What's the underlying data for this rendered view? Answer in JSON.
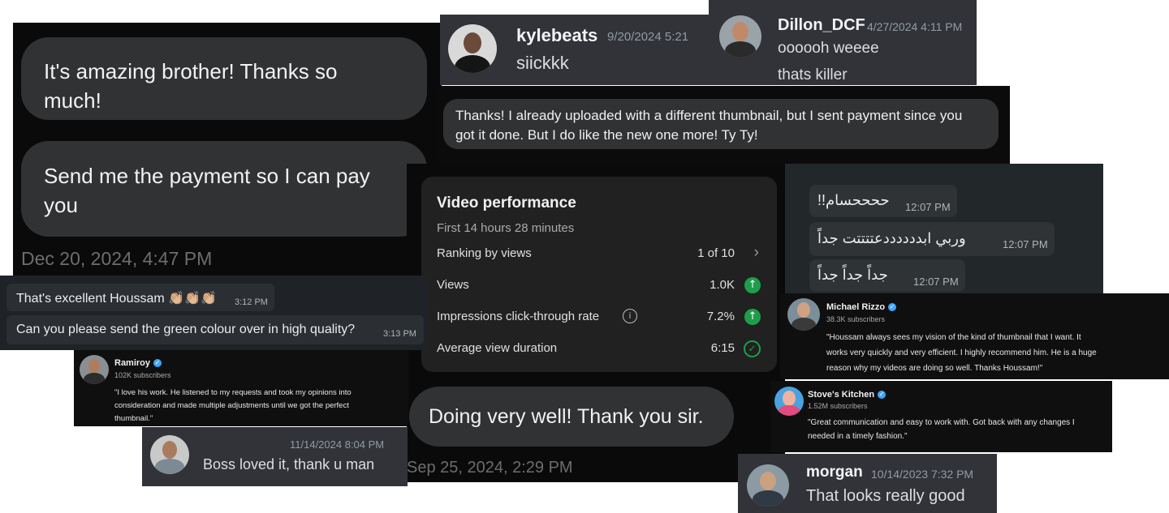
{
  "chat_black": {
    "msg1": "It's amazing brother! Thanks so much!",
    "msg1_l1": "It's amazing brother! Thanks so",
    "msg1_l2": "much!",
    "msg2_l1": "Send me the payment so I can pay",
    "msg2_l2": "you",
    "timestamp": "Dec 20, 2024, 4:47 PM"
  },
  "kylebeats": {
    "username": "kylebeats",
    "time": "9/20/2024 5:21",
    "message": "siickkk"
  },
  "dillon": {
    "username": "Dillon_DCF",
    "time": "4/27/2024 4:11 PM",
    "line1": "oooooh weeee",
    "line2": "thats killer"
  },
  "thanks_bubble": {
    "l1": "Thanks! I already uploaded with a different thumbnail, but I sent payment since you",
    "l2": "got it done. But I do like the new one more! Ty Ty!"
  },
  "video_performance": {
    "title": "Video performance",
    "subtitle": "First 14 hours 28 minutes",
    "rows": [
      {
        "label": "Ranking by views",
        "value": "1 of 10",
        "indicator": "chevron-right"
      },
      {
        "label": "Views",
        "value": "1.0K",
        "indicator": "up-arrow-green"
      },
      {
        "label": "Impressions click-through rate",
        "value": "7.2%",
        "indicator": "up-arrow-green"
      },
      {
        "label": "Average view duration",
        "value": "6:15",
        "indicator": "check-circle"
      }
    ],
    "reply": "Doing very well! Thank you sir.",
    "timestamp": "Sep 25, 2024, 2:29 PM"
  },
  "arabic_chat": {
    "messages": [
      {
        "text": "ححححسام!!",
        "time": "12:07 PM"
      },
      {
        "text": "وربي ابددددددعتتتتت جداً",
        "time": "12:07 PM"
      },
      {
        "text": "جداً جداً جداً",
        "time": "12:07 PM"
      }
    ]
  },
  "whatsapp_chat": {
    "messages": [
      {
        "text": "That's excellent Houssam 👏🏼👏🏼👏🏼",
        "time": "3:12 PM"
      },
      {
        "text": "Can you please send the green colour over in high quality?",
        "time": "3:13 PM"
      }
    ]
  },
  "ramiroy": {
    "name": "Ramiroy",
    "subs": "102K subscribers",
    "l1": "\"I love his work. He listened to my requests and took my opinions into",
    "l2": "consideration and made multiple adjustments until we got the perfect",
    "l3": "thumbnail.\""
  },
  "michael": {
    "name": "Michael Rizzo",
    "subs": "38.3K subscribers",
    "l1": "\"Houssam always sees my vision of the kind of thumbnail that I want. It",
    "l2": "works very quickly and very efficient. I highly recommend him. He is a huge",
    "l3": "reason why my videos are doing so well. Thanks Houssam!\""
  },
  "stoves": {
    "name": "Stove's Kitchen",
    "subs": "1.52M subscribers",
    "l1": "\"Great communication and easy to work with. Got back with any changes I",
    "l2": "needed in a timely fashion.\""
  },
  "boss": {
    "time": "11/14/2024 8:04 PM",
    "message": "Boss loved it, thank u man"
  },
  "morgan": {
    "username": "morgan",
    "time": "10/14/2023 7:32 PM",
    "message": "That looks really good"
  },
  "colors": {
    "discord_bg": "#313338",
    "imessage_bubble": "#333436",
    "wa_bubble": "#1f2c34",
    "green": "#1e9e4a",
    "verified": "#3ea6ff"
  }
}
